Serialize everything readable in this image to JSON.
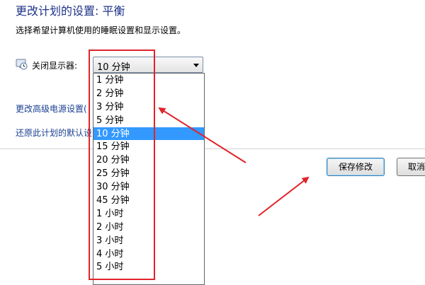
{
  "header": {
    "title": "更改计划的设置: 平衡",
    "description": "选择希望计算机使用的睡眠设置和显示设置。"
  },
  "display_setting": {
    "icon": "monitor-clock-icon",
    "label": "关闭显示器:",
    "selected_value": "10 分钟",
    "options": [
      "1 分钟",
      "2 分钟",
      "3 分钟",
      "5 分钟",
      "10 分钟",
      "15 分钟",
      "20 分钟",
      "25 分钟",
      "30 分钟",
      "45 分钟",
      "1 小时",
      "2 小时",
      "3 小时",
      "4 小时",
      "5 小时"
    ],
    "selected_index": 4
  },
  "links": {
    "advanced": "更改高级电源设置(",
    "restore": "还原此计划的默认设"
  },
  "buttons": {
    "save": "保存修改",
    "cancel": "取消"
  },
  "annotations": {
    "color": "#e0242b"
  }
}
